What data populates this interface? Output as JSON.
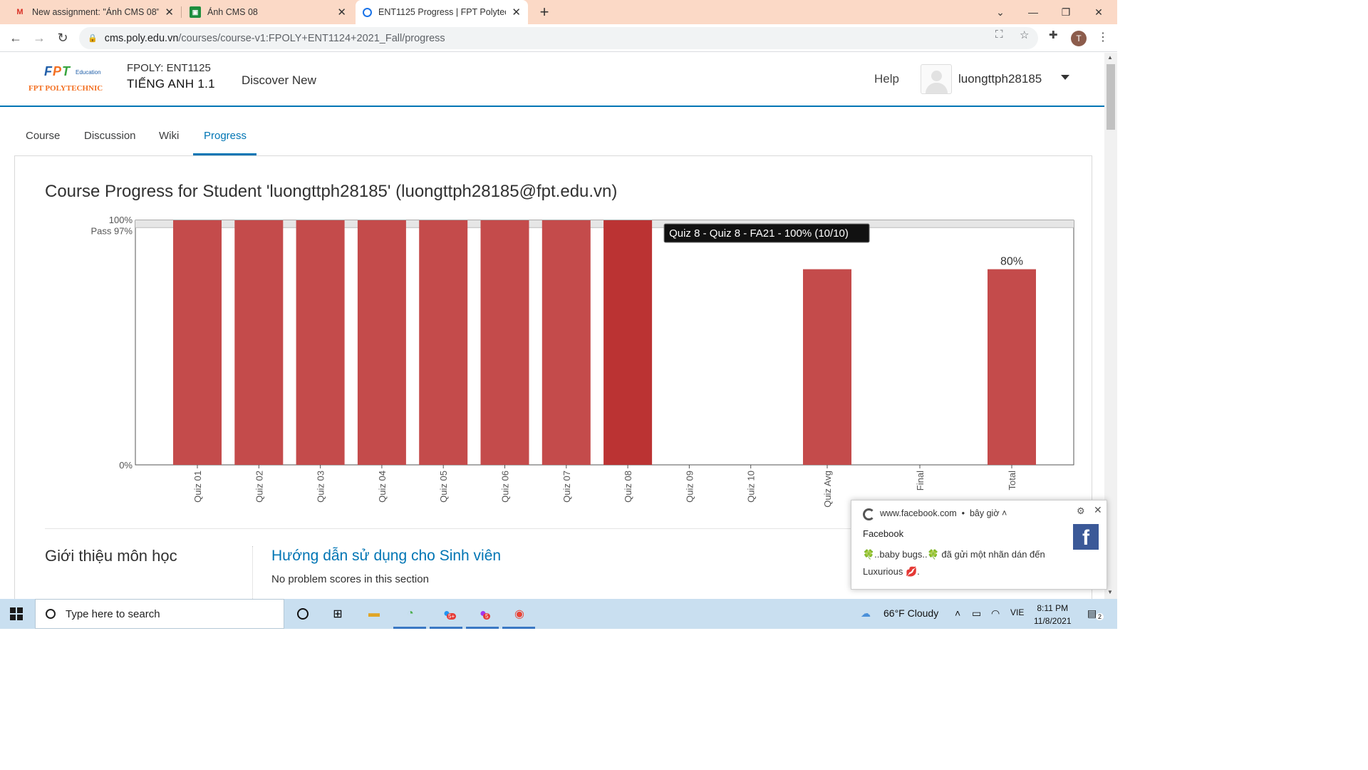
{
  "browser": {
    "tabs": [
      {
        "title": "New assignment: \"Ảnh CMS 08\"",
        "icon": "gmail-icon"
      },
      {
        "title": "Ảnh CMS 08",
        "icon": "classroom-icon"
      },
      {
        "title": "ENT1125 Progress | FPT Polytech",
        "icon": "edx-icon"
      }
    ],
    "url_host": "cms.poly.edu.vn",
    "url_path": "/courses/course-v1:FPOLY+ENT1124+2021_Fall/progress"
  },
  "header": {
    "logo_fpt": "FPT",
    "logo_edu": "Education",
    "logo_poly": "FPT POLYTECHNIC",
    "course_org": "FPOLY: ENT1125",
    "course_name": "TIẾNG ANH 1.1",
    "discover": "Discover New",
    "help": "Help",
    "username": "luongttph28185"
  },
  "course_nav": {
    "tabs": [
      "Course",
      "Discussion",
      "Wiki",
      "Progress"
    ],
    "active": "Progress"
  },
  "page": {
    "title": "Course Progress for Student 'luongttph28185' (luongttph28185@fpt.edu.vn)"
  },
  "chart_data": {
    "type": "bar",
    "categories": [
      "Quiz 01",
      "Quiz 02",
      "Quiz 03",
      "Quiz 04",
      "Quiz 05",
      "Quiz 06",
      "Quiz 07",
      "Quiz 08",
      "Quiz 09",
      "Quiz 10",
      "Quiz Avg",
      "Final",
      "Total"
    ],
    "values": [
      100,
      100,
      100,
      100,
      100,
      100,
      100,
      100,
      0,
      0,
      80,
      0,
      80
    ],
    "highlighted": "Quiz 08",
    "ylim": [
      0,
      100
    ],
    "y_ticks": [
      "100%",
      "0%"
    ],
    "pass_label": "Pass 97%",
    "pass_value": 97,
    "total_label": "80%",
    "tooltip": "Quiz 8 - Quiz 8 - FA21 - 100% (10/10)",
    "bar_color": "#c44b4b",
    "highlight_color": "#bb3333"
  },
  "section": {
    "left_title": "Giới thiệu môn học",
    "sub_title": "Hướng dẫn sử dụng cho Sinh viên",
    "sub_text": "No problem scores in this section"
  },
  "notification": {
    "source": "www.facebook.com",
    "time": "bây giờ",
    "app": "Facebook",
    "message": "🍀..baby bugs..🍀 đã gửi một nhãn dán đến Luxurious 💋."
  },
  "taskbar": {
    "search_placeholder": "Type here to search",
    "weather": "66°F  Cloudy",
    "lang": "VIE",
    "time": "8:11 PM",
    "date": "11/8/2021",
    "notif_count": "2",
    "badge_zalo": "5+",
    "badge_messenger": "5"
  }
}
